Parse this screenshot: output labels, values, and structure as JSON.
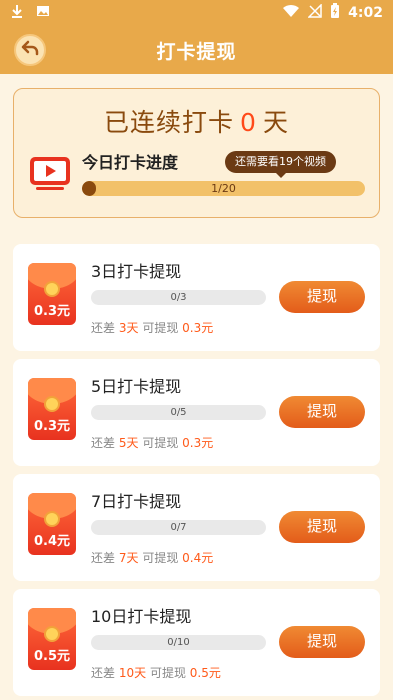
{
  "status_bar": {
    "time": "4:02",
    "icons": [
      "download-icon",
      "image-icon",
      "wifi-icon",
      "no-signal-icon",
      "battery-charging-icon"
    ]
  },
  "header": {
    "title": "打卡提现",
    "back_icon": "back-arrow-icon"
  },
  "streak": {
    "prefix": "已连续打卡",
    "days": "0",
    "suffix": "天",
    "progress_label": "今日打卡进度",
    "tooltip": "还需要看19个视频",
    "progress_text": "1/20",
    "progress_fraction": 0.05,
    "video_icon": "video-play-icon"
  },
  "tasks": [
    {
      "title": "3日打卡提现",
      "amount": "0.3元",
      "progress_text": "0/3",
      "progress_fraction": 0,
      "sub_prefix": "还差",
      "remaining": "3天",
      "sub_mid": "可提现",
      "reward": "0.3元",
      "button": "提现"
    },
    {
      "title": "5日打卡提现",
      "amount": "0.3元",
      "progress_text": "0/5",
      "progress_fraction": 0,
      "sub_prefix": "还差",
      "remaining": "5天",
      "sub_mid": "可提现",
      "reward": "0.3元",
      "button": "提现"
    },
    {
      "title": "7日打卡提现",
      "amount": "0.4元",
      "progress_text": "0/7",
      "progress_fraction": 0,
      "sub_prefix": "还差",
      "remaining": "7天",
      "sub_mid": "可提现",
      "reward": "0.4元",
      "button": "提现"
    },
    {
      "title": "10日打卡提现",
      "amount": "0.5元",
      "progress_text": "0/10",
      "progress_fraction": 0,
      "sub_prefix": "还差",
      "remaining": "10天",
      "sub_mid": "可提现",
      "reward": "0.5元",
      "button": "提现"
    }
  ],
  "colors": {
    "header_bg": "#e8a94a",
    "page_bg": "#fdf4e3",
    "accent_orange": "#e35c1a",
    "highlight_red": "#ff4a1a",
    "brown": "#8a4a0e"
  }
}
